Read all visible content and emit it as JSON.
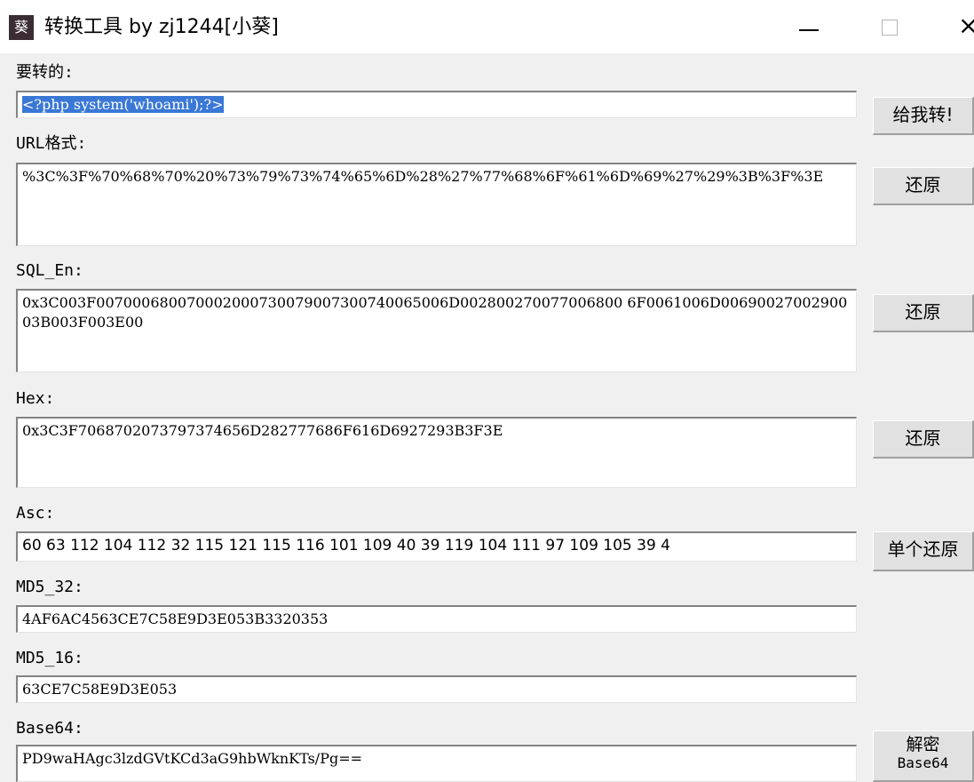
{
  "window": {
    "icon_glyph": "葵",
    "title": "转换工具 by zj1244[小葵]",
    "minimize_icon": "minimize-icon",
    "maximize_icon": "maximize-icon",
    "close_icon": "close-icon",
    "close_glyph": "×"
  },
  "input": {
    "label": "要转的:",
    "value": "<?php system('whoami');?>",
    "button": "给我转!"
  },
  "url": {
    "label": "URL格式:",
    "value": "%3C%3F%70%68%70%20%73%79%73%74%65%6D%28%27%77%68%6F%61%6D%69%27%29%3B%3F%3E",
    "button": "还原"
  },
  "sql_en": {
    "label": "SQL_En:",
    "value": "0x3C003F007000680070002000730079007300740065006D002800270077006800 6F0061006D0069002700290003B003F003E00",
    "button": "还原"
  },
  "hex": {
    "label": "Hex:",
    "value": "0x3C3F7068702073797374656D282777686F616D6927293B3F3E",
    "button": "还原"
  },
  "asc": {
    "label": "Asc:",
    "value": "60 63 112 104 112 32 115 121 115 116 101 109 40 39 119 104 111 97 109 105 39 4",
    "button": "单个还原"
  },
  "md5_32": {
    "label": "MD5_32:",
    "value": "4AF6AC4563CE7C58E9D3E053B3320353"
  },
  "md5_16": {
    "label": "MD5_16:",
    "value": "63CE7C58E9D3E053"
  },
  "base64": {
    "label": "Base64:",
    "value": "PD9waHAgc3lzdGVtKCd3aG9hbWknKTs/Pg==",
    "button_line1": "解密",
    "button_line2": "Base64"
  }
}
